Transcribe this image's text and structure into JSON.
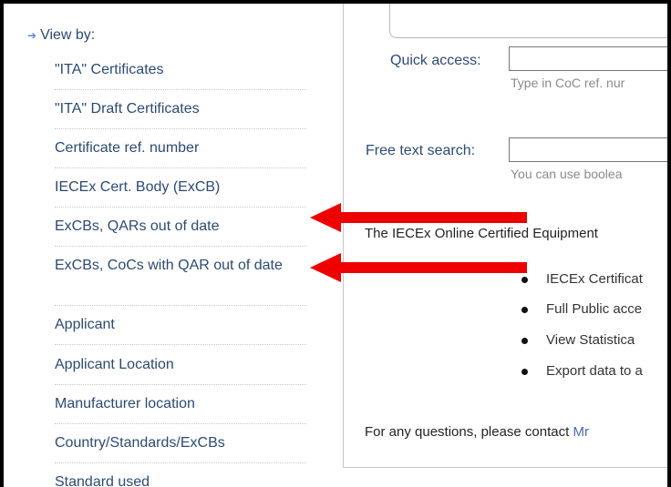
{
  "sidebar": {
    "view_by_label": "View by:",
    "items": [
      {
        "label": "\"ITA\" Certificates"
      },
      {
        "label": "\"ITA\" Draft Certificates"
      },
      {
        "label": "Certificate ref. number"
      },
      {
        "label": "IECEx Cert. Body (ExCB)"
      },
      {
        "label": "ExCBs, QARs out of date"
      },
      {
        "label": "ExCBs, CoCs with QAR out of date"
      },
      {
        "label": "Applicant"
      },
      {
        "label": "Applicant Location"
      },
      {
        "label": "Manufacturer location"
      },
      {
        "label": "Country/Standards/ExCBs"
      },
      {
        "label": "Standard used"
      }
    ]
  },
  "search": {
    "quick_access_label": "Quick access:",
    "quick_access_value": "",
    "quick_access_hint": "Type in CoC ref. nur",
    "free_text_label": "Free text search:",
    "free_text_value": "",
    "free_text_hint": "You can use boolea"
  },
  "main": {
    "intro_text": "The IECEx Online Certified Equipment",
    "bullets": [
      "IECEx Certificat",
      "Full Public acce",
      "View Statistica",
      "Export data to a"
    ],
    "contact_prefix": "For any questions, please contact ",
    "contact_link": "Mr"
  },
  "colors": {
    "link_blue": "#2b4a75",
    "annotation_red": "#ee0000"
  }
}
